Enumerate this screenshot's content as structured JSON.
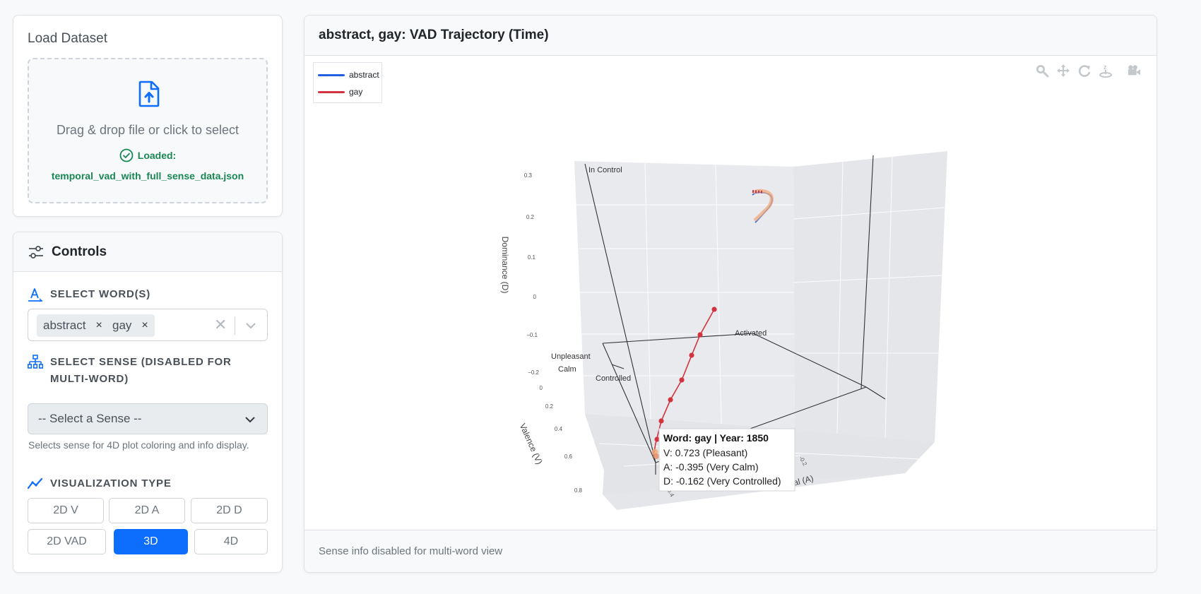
{
  "load": {
    "title": "Load Dataset",
    "dropzone_text": "Drag & drop file or click to select",
    "loaded_label": "Loaded:",
    "filename": "temporal_vad_with_full_sense_data.json"
  },
  "controls": {
    "title": "Controls",
    "select_words": {
      "label": "SELECT WORD(S)",
      "chips": [
        "abstract",
        "gay"
      ],
      "remove_glyph": "×",
      "clear_glyph": "✕"
    },
    "select_sense": {
      "label": "SELECT SENSE (DISABLED FOR MULTI-WORD)",
      "placeholder": "-- Select a Sense --",
      "help": "Selects sense for 4D plot coloring and info display."
    },
    "visualization": {
      "label": "VISUALIZATION TYPE",
      "buttons": [
        "2D V",
        "2D A",
        "2D D",
        "2D VAD",
        "3D",
        "4D"
      ],
      "active": "3D"
    }
  },
  "plot": {
    "title": "abstract, gay: VAD Trajectory (Time)",
    "footer": "Sense info disabled for multi-word view",
    "legend": [
      {
        "name": "abstract",
        "color": "#1f5fe0"
      },
      {
        "name": "gay",
        "color": "#d1343f"
      }
    ],
    "modebar_icons": [
      "zoom-icon",
      "pan-icon",
      "orbit-rotate-icon",
      "turntable-rotate-icon",
      "reset-camera-icon"
    ],
    "scene_labels": {
      "dominance_axis": "Dominance (D)",
      "valence_axis": "Valence (V)",
      "arousal_axis": "Arousal (A)",
      "in_control": "In Control",
      "controlled": "Controlled",
      "activated": "Activated",
      "unpleasant": "Unpleasant",
      "calm": "Calm",
      "d_ticks": [
        "0.3",
        "0.2",
        "0.1",
        "0",
        "−0.1",
        "−0.2"
      ],
      "v_ticks": [
        "0",
        "0.2",
        "0.4",
        "0.6",
        "0.8"
      ],
      "a_ticks": [
        "-0.4",
        "-0.2"
      ]
    },
    "tooltip": {
      "title": "Word: gay | Year: 1850",
      "v": "V: 0.723 (Pleasant)",
      "a": "A: -0.395 (Very Calm)",
      "d": "D: -0.162 (Very Controlled)"
    }
  },
  "colors": {
    "accent": "#0d6efd",
    "success": "#198754",
    "abstract_series": "#1f5fe0",
    "gay_series": "#d1343f"
  }
}
